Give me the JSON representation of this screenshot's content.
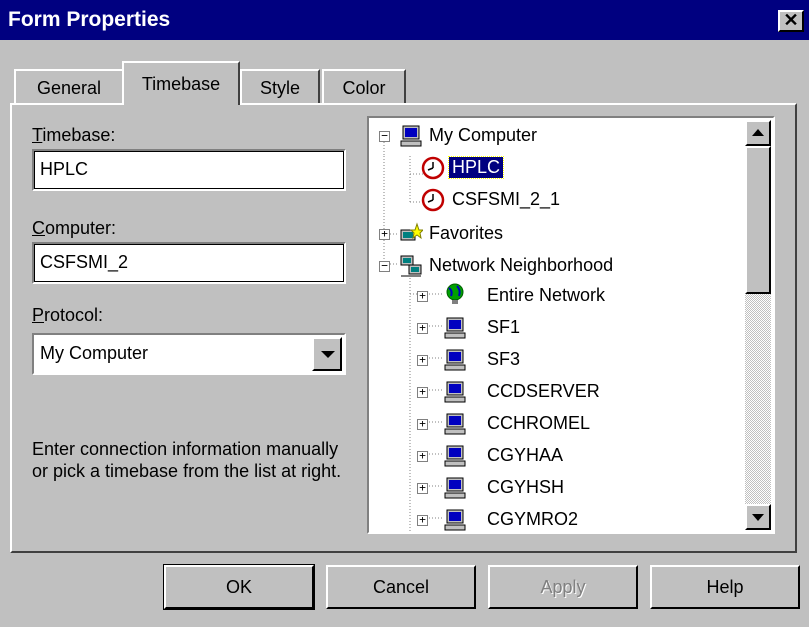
{
  "window": {
    "title": "Form Properties",
    "close_glyph": "✕"
  },
  "tabs": [
    {
      "label": "General",
      "active": false
    },
    {
      "label": "Timebase",
      "active": true
    },
    {
      "label": "Style",
      "active": false
    },
    {
      "label": "Color",
      "active": false
    }
  ],
  "form": {
    "timebase_label_accel": "T",
    "timebase_label_rest": "imebase:",
    "timebase_value": "HPLC",
    "computer_label_accel": "C",
    "computer_label_rest": "omputer:",
    "computer_value": "CSFSMI_2",
    "protocol_label_accel": "P",
    "protocol_label_rest": "rotocol:",
    "protocol_value": "My Computer",
    "help_text": "Enter connection information manually or pick a timebase from the list at right."
  },
  "tree": {
    "items": [
      {
        "label": "My Computer",
        "icon": "computer-icon",
        "expander": "−"
      },
      {
        "label": "HPLC",
        "icon": "clock-icon",
        "selected": true
      },
      {
        "label": "CSFSMI_2_1",
        "icon": "clock-icon"
      },
      {
        "label": "Favorites",
        "icon": "favorites-icon",
        "expander": "+"
      },
      {
        "label": "Network Neighborhood",
        "icon": "network-icon",
        "expander": "−"
      },
      {
        "label": "Entire Network",
        "icon": "globe-icon",
        "expander": "+"
      },
      {
        "label": "SF1",
        "icon": "computer-icon",
        "expander": "+"
      },
      {
        "label": "SF3",
        "icon": "computer-icon",
        "expander": "+"
      },
      {
        "label": "CCDSERVER",
        "icon": "computer-icon",
        "expander": "+"
      },
      {
        "label": "CCHROMEL",
        "icon": "computer-icon",
        "expander": "+"
      },
      {
        "label": "CGYHAA",
        "icon": "computer-icon",
        "expander": "+"
      },
      {
        "label": "CGYHSH",
        "icon": "computer-icon",
        "expander": "+"
      },
      {
        "label": "CGYMRO2",
        "icon": "computer-icon",
        "expander": "+"
      }
    ],
    "selected_bg": "#000080"
  },
  "buttons": {
    "ok": "OK",
    "cancel": "Cancel",
    "apply": "Apply",
    "help": "Help"
  }
}
